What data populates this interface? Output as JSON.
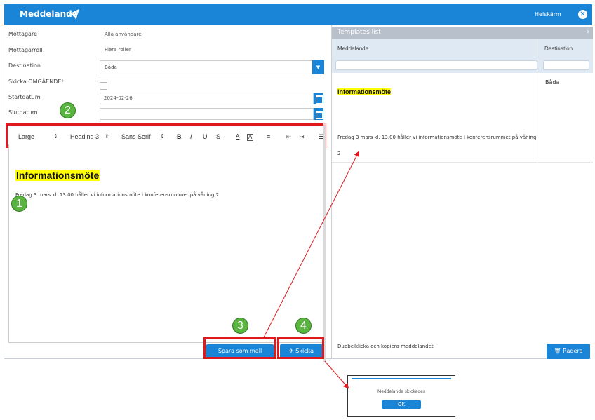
{
  "window": {
    "title": "Meddelande",
    "fullscreen_label": "Helskärm"
  },
  "form": {
    "recipient_label": "Mottagare",
    "recipient_value": "Alla användare",
    "role_label": "Mottagarroll",
    "role_value": "Flera roller",
    "destination_label": "Destination",
    "destination_value": "Båda",
    "send_now_label": "Skicka OMGÅENDE!",
    "start_label": "Startdatum",
    "start_value": "2024-02-26",
    "end_label": "Slutdatum",
    "end_value": ""
  },
  "toolbar": {
    "size": "Large",
    "heading": "Heading 3",
    "font": "Sans Serif",
    "bold": "B",
    "italic": "I",
    "underline": "U",
    "strike": "S"
  },
  "editor": {
    "heading": "Informationsmöte",
    "body": "Fredag 3 mars kl. 13.00 håller vi informationsmöte i konferensrummet på våning 2"
  },
  "buttons": {
    "save_template": "Spara som mall",
    "send": "Skicka",
    "delete": "Radera"
  },
  "templates": {
    "header": "Templates list",
    "col_message": "Meddelande",
    "col_destination": "Destination",
    "rows": [
      {
        "title": "Informationsmöte",
        "text": "Fredag 3 mars kl. 13.00 håller vi informationsmöte i konferensrummet på våning 2",
        "destination": "Båda"
      }
    ],
    "hint": "Dubbelklicka och kopiera meddelandet"
  },
  "dialog": {
    "message": "Meddelande skickades",
    "ok": "OK"
  },
  "callouts": [
    "1",
    "2",
    "3",
    "4"
  ],
  "colors": {
    "accent": "#1a84d6",
    "highlight": "#ffff00",
    "callout_frame": "#e0191f",
    "callout_badge": "#5ab440"
  }
}
